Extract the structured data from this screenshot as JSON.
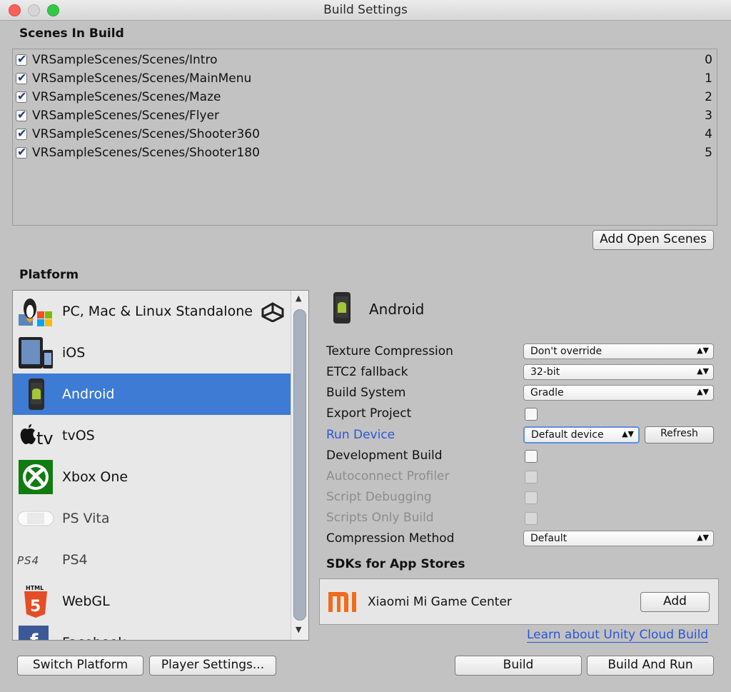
{
  "window": {
    "title": "Build Settings"
  },
  "scenes_section": {
    "heading": "Scenes In Build",
    "scenes": [
      {
        "path": "VRSampleScenes/Scenes/Intro",
        "index": "0",
        "checked": true
      },
      {
        "path": "VRSampleScenes/Scenes/MainMenu",
        "index": "1",
        "checked": true
      },
      {
        "path": "VRSampleScenes/Scenes/Maze",
        "index": "2",
        "checked": true
      },
      {
        "path": "VRSampleScenes/Scenes/Flyer",
        "index": "3",
        "checked": true
      },
      {
        "path": "VRSampleScenes/Scenes/Shooter360",
        "index": "4",
        "checked": true
      },
      {
        "path": "VRSampleScenes/Scenes/Shooter180",
        "index": "5",
        "checked": true
      }
    ],
    "add_open_scenes_label": "Add Open Scenes"
  },
  "platform_section": {
    "heading": "Platform",
    "platforms": [
      {
        "label": "PC, Mac & Linux Standalone",
        "icon": "standalone-icon"
      },
      {
        "label": "iOS",
        "icon": "ios-device-icon"
      },
      {
        "label": "Android",
        "icon": "android-phone-icon",
        "selected": true
      },
      {
        "label": "tvOS",
        "icon": "apple-tv-icon"
      },
      {
        "label": "Xbox One",
        "icon": "xbox-icon"
      },
      {
        "label": "PS Vita",
        "icon": "ps-vita-icon"
      },
      {
        "label": "PS4",
        "icon": "ps4-icon"
      },
      {
        "label": "WebGL",
        "icon": "html5-icon"
      },
      {
        "label": "Facebook",
        "icon": "facebook-icon"
      }
    ]
  },
  "settings": {
    "platform_title": "Android",
    "texture_compression": {
      "label": "Texture Compression",
      "value": "Don't override"
    },
    "etc2_fallback": {
      "label": "ETC2 fallback",
      "value": "32-bit"
    },
    "build_system": {
      "label": "Build System",
      "value": "Gradle"
    },
    "export_project": {
      "label": "Export Project"
    },
    "run_device": {
      "label": "Run Device",
      "value": "Default device",
      "refresh_label": "Refresh"
    },
    "development_build": {
      "label": "Development Build"
    },
    "autoconnect_profiler": {
      "label": "Autoconnect Profiler"
    },
    "script_debugging": {
      "label": "Script Debugging"
    },
    "scripts_only_build": {
      "label": "Scripts Only Build"
    },
    "compression_method": {
      "label": "Compression Method",
      "value": "Default"
    }
  },
  "sdks": {
    "heading": "SDKs for App Stores",
    "item_name": "Xiaomi Mi Game Center",
    "add_label": "Add",
    "cloud_build_link": "Learn about Unity Cloud Build"
  },
  "footer": {
    "switch_platform": "Switch Platform",
    "player_settings": "Player Settings...",
    "build": "Build",
    "build_and_run": "Build And Run"
  },
  "colors": {
    "selection": "#3d7bd5",
    "link": "#2b56d6",
    "mi_orange": "#f06b1c",
    "xbox_green": "#107c10"
  }
}
